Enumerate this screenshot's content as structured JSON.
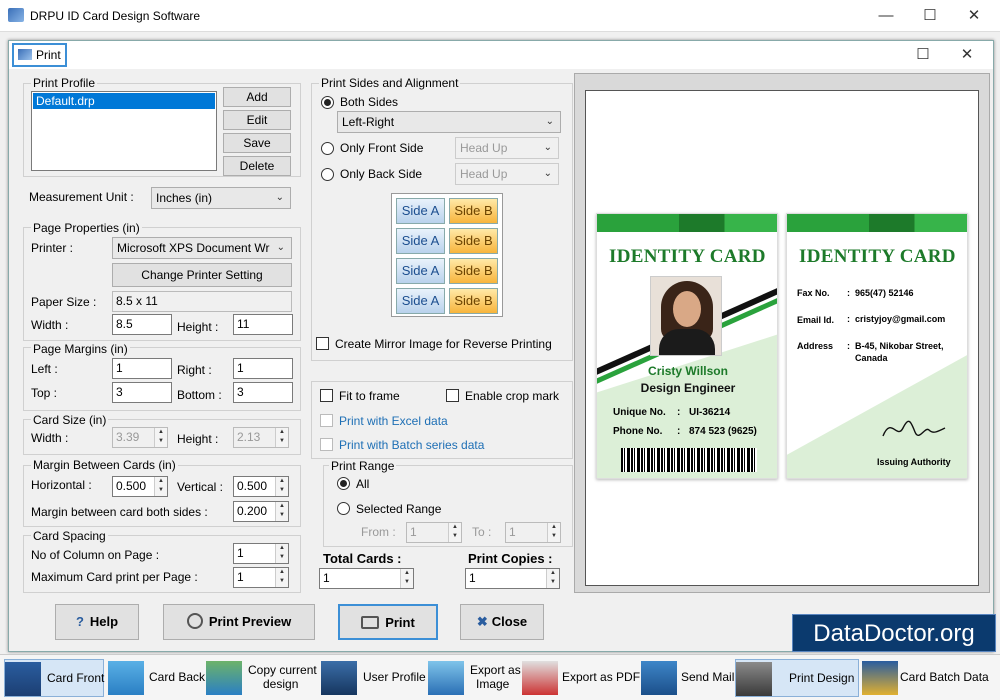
{
  "app": {
    "title": "DRPU ID Card Design Software"
  },
  "dialog": {
    "tab": "Print"
  },
  "profile": {
    "group": "Print Profile",
    "items": [
      "Default.drp"
    ],
    "add": "Add",
    "edit": "Edit",
    "save": "Save",
    "delete": "Delete"
  },
  "measurement": {
    "label": "Measurement Unit :",
    "value": "Inches (in)"
  },
  "page": {
    "group": "Page Properties (in)",
    "printer_label": "Printer :",
    "printer_value": "Microsoft XPS Document Wr",
    "change": "Change Printer Setting",
    "paper_label": "Paper Size :",
    "paper_value": "8.5 x 11",
    "width_label": "Width :",
    "width_value": "8.5",
    "height_label": "Height :",
    "height_value": "11"
  },
  "margins": {
    "group": "Page Margins (in)",
    "left_label": "Left :",
    "left_value": "1",
    "right_label": "Right :",
    "right_value": "1",
    "top_label": "Top :",
    "top_value": "3",
    "bottom_label": "Bottom :",
    "bottom_value": "3"
  },
  "cardsize": {
    "group": "Card Size (in)",
    "width_label": "Width :",
    "width_value": "3.39",
    "height_label": "Height :",
    "height_value": "2.13"
  },
  "between": {
    "group": "Margin Between Cards (in)",
    "h_label": "Horizontal :",
    "h_value": "0.500",
    "v_label": "Vertical :",
    "v_value": "0.500",
    "both_label": "Margin between card both sides :",
    "both_value": "0.200"
  },
  "spacing": {
    "group": "Card Spacing",
    "cols_label": "No of Column on Page :",
    "cols_value": "1",
    "max_label": "Maximum Card print per Page :",
    "max_value": "1"
  },
  "sides": {
    "group": "Print Sides and Alignment",
    "both": "Both Sides",
    "both_combo": "Left-Right",
    "front": "Only Front Side",
    "front_combo": "Head Up",
    "back": "Only Back Side",
    "back_combo": "Head Up",
    "side_a": "Side A",
    "side_b": "Side B",
    "mirror": "Create Mirror Image for Reverse Printing"
  },
  "options": {
    "fit": "Fit to frame",
    "crop": "Enable crop mark",
    "excel": "Print with Excel data",
    "batch": "Print with Batch series data"
  },
  "range": {
    "group": "Print Range",
    "all": "All",
    "selected": "Selected Range",
    "from_label": "From :",
    "from_value": "1",
    "to_label": "To :",
    "to_value": "1"
  },
  "totals": {
    "cards_label": "Total Cards :",
    "cards_value": "1",
    "copies_label": "Print Copies :",
    "copies_value": "1"
  },
  "buttons": {
    "help": "Help",
    "preview": "Print Preview",
    "print": "Print",
    "close": "Close"
  },
  "front_card": {
    "title": "IDENTITY CARD",
    "name": "Cristy Willson",
    "role": "Design Engineer",
    "unique_label": "Unique No.",
    "unique_value": "UI-36214",
    "phone_label": "Phone No.",
    "phone_value": "874 523 (9625)",
    "colon": ":"
  },
  "back_card": {
    "title": "IDENTITY CARD",
    "fax_label": "Fax No.",
    "fax_value": "965(47) 52146",
    "email_label": "Email Id.",
    "email_value": "cristyjoy@gmail.com",
    "address_label": "Address",
    "address_value1": "B-45, Nikobar Street,",
    "address_value2": "Canada",
    "authority": "Issuing Authority",
    "colon": ":"
  },
  "watermark": "DataDoctor.org",
  "toolbar": {
    "card_front": "Card Front",
    "card_back": "Card Back",
    "copy1": "Copy current",
    "copy2": "design",
    "user_profile": "User Profile",
    "export1": "Export as",
    "export2": "Image",
    "export_pdf": "Export as PDF",
    "send_mail": "Send Mail",
    "print_design": "Print Design",
    "batch": "Card Batch Data"
  },
  "colors": {
    "accent": "#3c8fd6",
    "card_green": "#1d7a2a",
    "watermark_bg": "#0b3a6e"
  }
}
